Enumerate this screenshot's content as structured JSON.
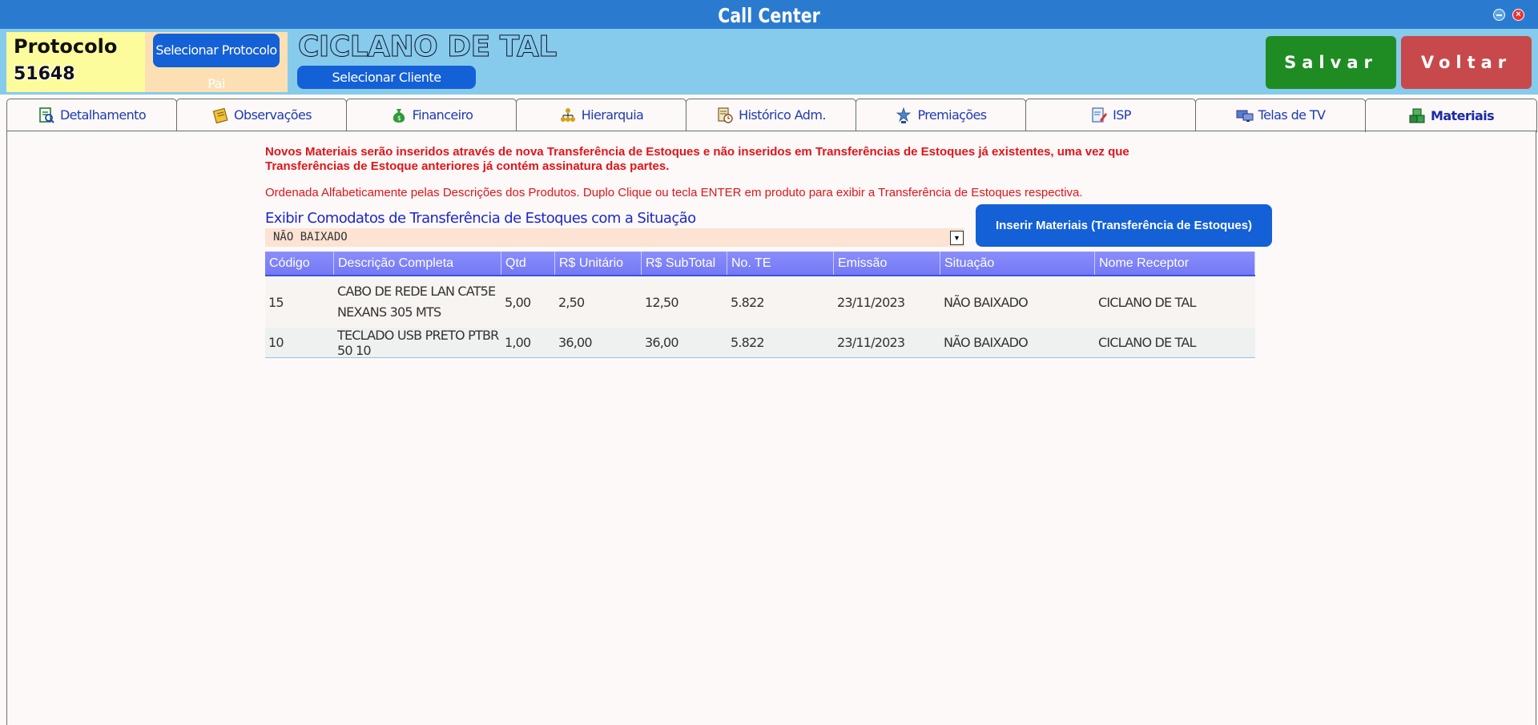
{
  "window": {
    "title": "Call Center"
  },
  "header": {
    "protocol_label": "Protocolo",
    "protocol_number": "51648",
    "select_parent_label": "Selecionar Protocolo Pai",
    "client_name": "CICLANO DE TAL",
    "select_client_label": "Selecionar Cliente",
    "save_label": "Salvar",
    "back_label": "Voltar"
  },
  "tabs": [
    {
      "label": "Detalhamento",
      "icon": "document-search-icon"
    },
    {
      "label": "Observações",
      "icon": "notes-icon"
    },
    {
      "label": "Financeiro",
      "icon": "money-bag-icon"
    },
    {
      "label": "Hierarquia",
      "icon": "hierarchy-icon"
    },
    {
      "label": "Histórico Adm.",
      "icon": "history-icon"
    },
    {
      "label": "Premiações",
      "icon": "award-icon"
    },
    {
      "label": "ISP",
      "icon": "isp-icon"
    },
    {
      "label": "Telas de TV",
      "icon": "tv-screens-icon"
    },
    {
      "label": "Materiais",
      "icon": "materials-icon",
      "active": true
    }
  ],
  "content": {
    "notice_main": "Novos Materiais serão inseridos através de nova Transferência de Estoques e não inseridos em Transferências de Estoques já existentes, uma vez que Transferências de Estoque anteriores já contém assinatura das partes.",
    "notice_order": "Ordenada Alfabeticamente pelas Descrições dos Produtos. Duplo Clique ou tecla ENTER em produto para exibir a Transferência de Estoques respectiva.",
    "situation_label": "Exibir Comodatos de Transferência de Estoques com a Situação",
    "situation_value": "NÃO BAIXADO",
    "insert_button_label": "Inserir Materiais (Transferência de Estoques)"
  },
  "table": {
    "columns": [
      "Código",
      "Descrição Completa",
      "Qtd",
      "R$ Unitário",
      "R$ SubTotal",
      "No. TE",
      "Emissão",
      "Situação",
      "Nome Receptor"
    ],
    "rows": [
      [
        "15",
        "CABO DE REDE LAN CAT5E NEXANS 305 MTS",
        "5,00",
        "2,50",
        "12,50",
        "5.822",
        "23/11/2023",
        "NÃO BAIXADO",
        "CICLANO DE TAL"
      ],
      [
        "10",
        "TECLADO USB PRETO PTBR 50 10",
        "1,00",
        "36,00",
        "36,00",
        "5.822",
        "23/11/2023",
        "NÃO BAIXADO",
        "CICLANO DE TAL"
      ]
    ]
  },
  "colors": {
    "titlebar": "#2a7bd0",
    "header_bg": "#86cbeb",
    "save": "#1e8c23",
    "back": "#c8494b",
    "primary_button": "#1460d6",
    "notice_text": "#e1141a",
    "table_header": "#7c80f8"
  }
}
